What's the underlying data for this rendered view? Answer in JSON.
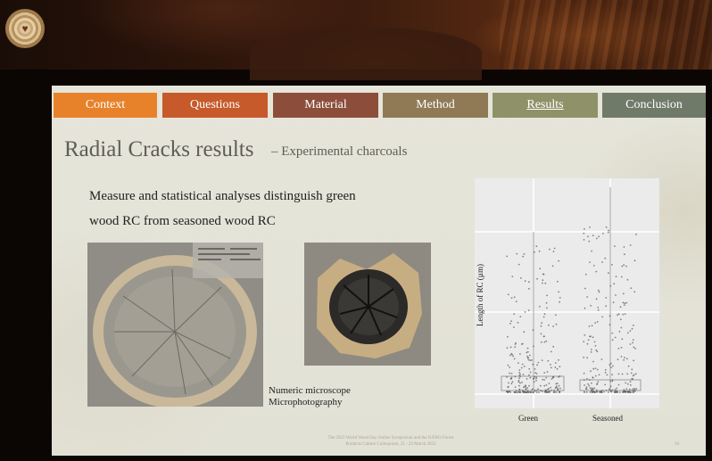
{
  "nav": {
    "tabs": [
      {
        "label": "Context",
        "color": "#e8822a",
        "active": false
      },
      {
        "label": "Questions",
        "color": "#c65a2a",
        "active": false
      },
      {
        "label": "Material",
        "color": "#8c4e3b",
        "active": false
      },
      {
        "label": "Method",
        "color": "#8f7a55",
        "active": false
      },
      {
        "label": "Results",
        "color": "#8f9268",
        "active": true
      },
      {
        "label": "Conclusion",
        "color": "#707a69",
        "active": false
      }
    ]
  },
  "slide": {
    "title": "Radial Cracks results",
    "subtitle": "– Experimental charcoals",
    "body_line1": "Measure and statistical analyses distinguish green",
    "body_line2": "wood RC from seasoned wood RC",
    "caption_line1": "Numeric microscope",
    "caption_line2": "Microphotography",
    "footer_line1": "The 2023 World Wood Day Online Symposium and the IUFRO Forest",
    "footer_line2": "Products Culture Colloquium, 21 - 22 March 2023",
    "page_number": "16"
  },
  "chart_data": {
    "type": "scatter",
    "ylabel": "Length of RC (µm)",
    "categories": [
      "Green",
      "Seasoned"
    ],
    "grid": true,
    "legend": "none"
  }
}
